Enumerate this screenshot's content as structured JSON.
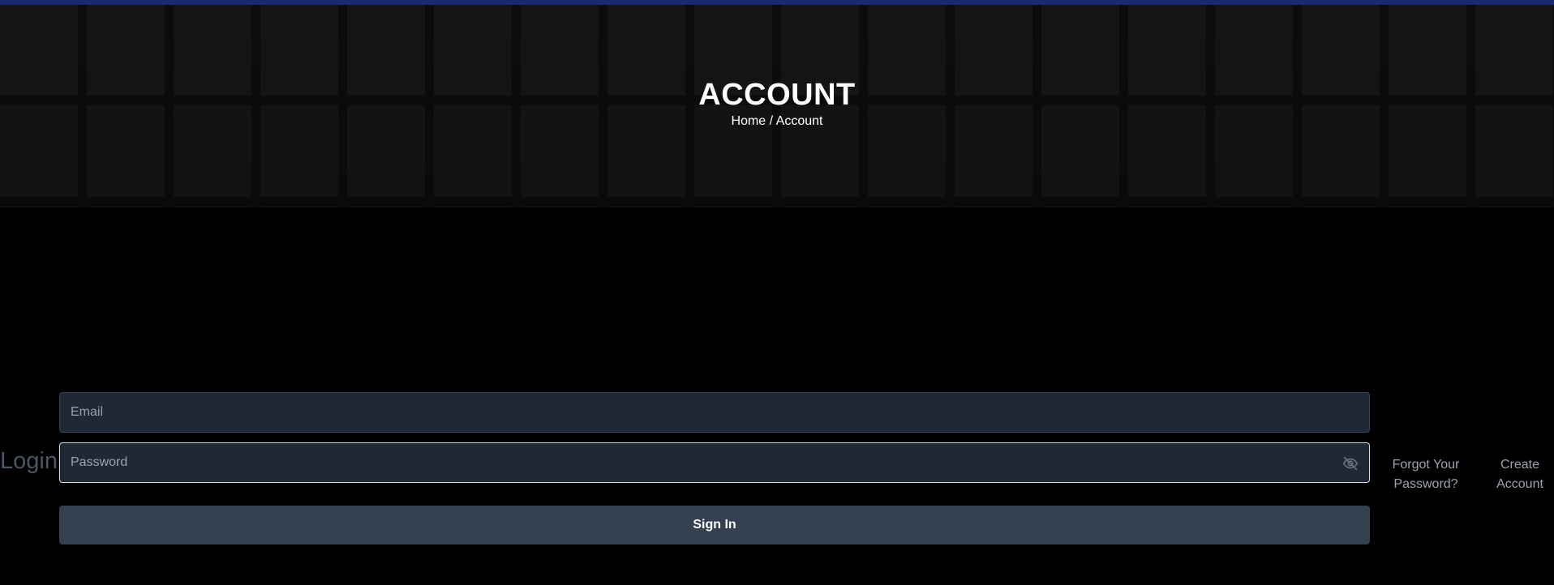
{
  "hero": {
    "title": "ACCOUNT",
    "breadcrumb": "Home / Account"
  },
  "login": {
    "label": "Login",
    "email_placeholder": "Email",
    "password_placeholder": "Password",
    "password_toggle_icon": "eye-off-icon",
    "signin_label": "Sign In",
    "forgot_label": "Forgot Your Password?",
    "create_label": "Create Account"
  },
  "colors": {
    "background": "#000000",
    "hero": "#151515",
    "field": "#1e2836",
    "button": "#354051",
    "accent_bar": "#1a2a6e"
  }
}
